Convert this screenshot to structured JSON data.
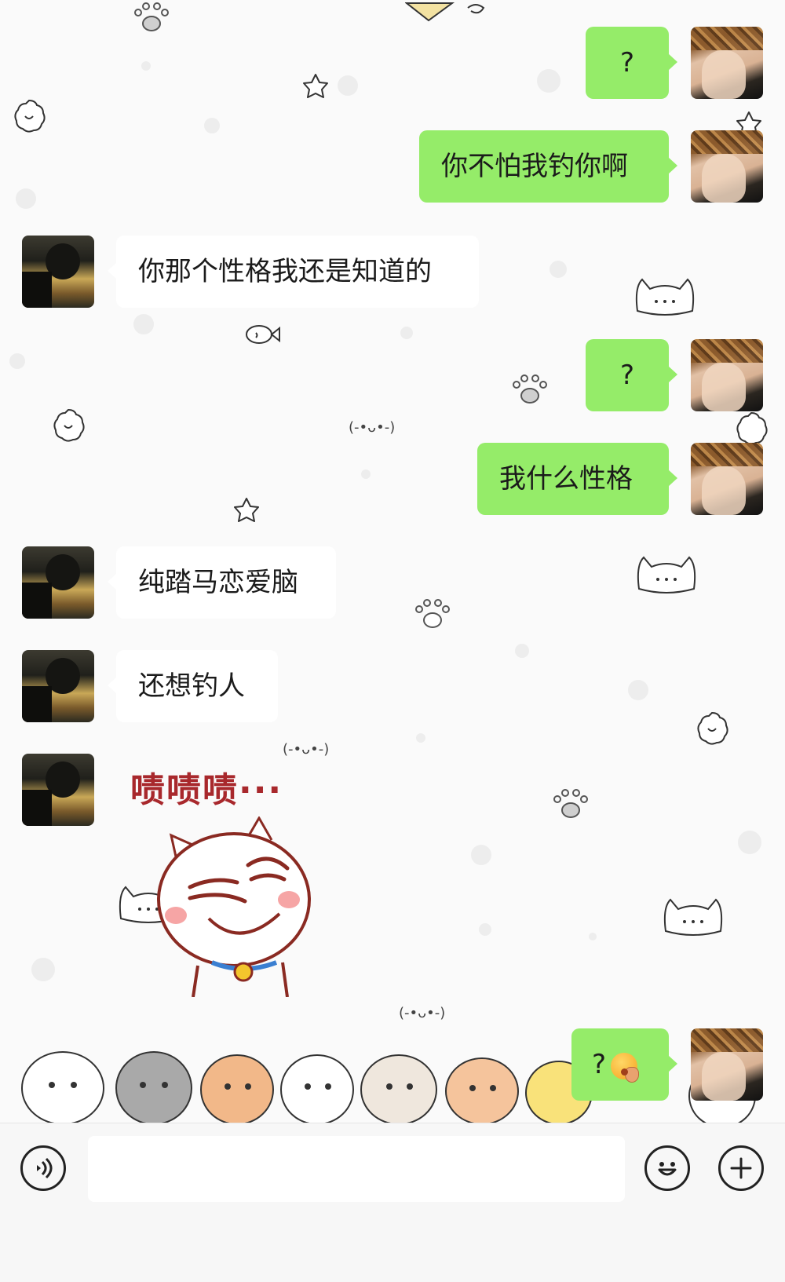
{
  "messages": [
    {
      "from": "me",
      "text": "?"
    },
    {
      "from": "me",
      "text": "你不怕我钓你啊"
    },
    {
      "from": "them",
      "text": "你那个性格我还是知道的"
    },
    {
      "from": "me",
      "text": "?"
    },
    {
      "from": "me",
      "text": "我什么性格"
    },
    {
      "from": "them",
      "text": "纯踏马恋爱脑"
    },
    {
      "from": "them",
      "text": "还想钓人"
    },
    {
      "from": "them",
      "type": "sticker",
      "text": "啧啧啧···"
    },
    {
      "from": "me",
      "text": "?",
      "emoji": "kiss-face-emoji"
    }
  ],
  "wallpaper": {
    "kaomoji": "(-•ᴗ•-)",
    "background": "#fafafa"
  },
  "input_bar": {
    "voice_icon": "voice-icon",
    "emoji_icon": "smiley-icon",
    "plus_icon": "plus-icon",
    "value": ""
  },
  "colors": {
    "my_bubble": "#95ec69",
    "their_bubble": "#ffffff",
    "sticker_text": "#a8282c"
  }
}
